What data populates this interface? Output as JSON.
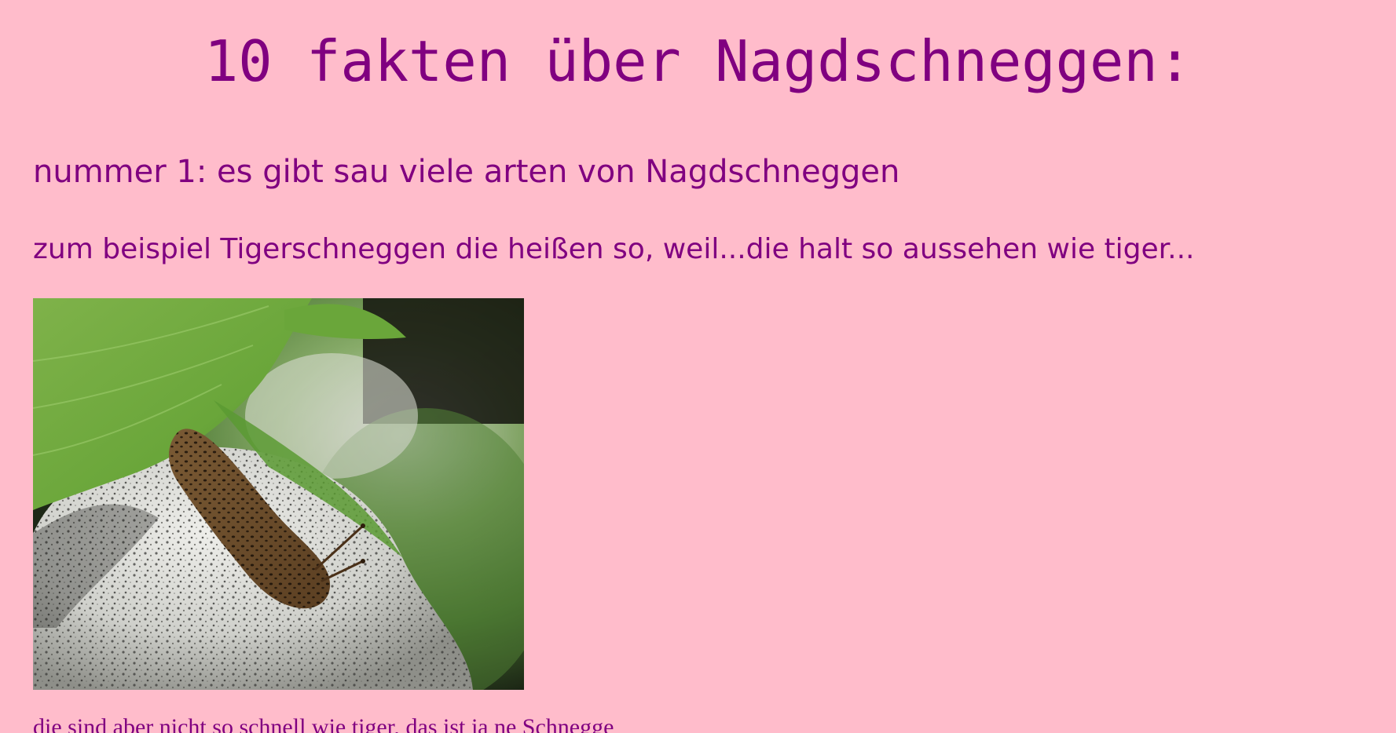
{
  "page": {
    "title": "10 fakten über Nagdschneggen:",
    "background_color": "#ffbccb",
    "text_color": "#800080"
  },
  "fact1": {
    "heading": "nummer 1: es gibt sau viele arten von Nagdschneggen",
    "example": "zum beispiel Tigerschneggen die heißen so, weil...die halt so aussehen wie tiger...",
    "image": "tiger-slug-on-granite-stone-under-hosta-leaf",
    "follow_up": "die sind aber nicht so schnell wie tiger, das ist ja ne Schnegge"
  }
}
